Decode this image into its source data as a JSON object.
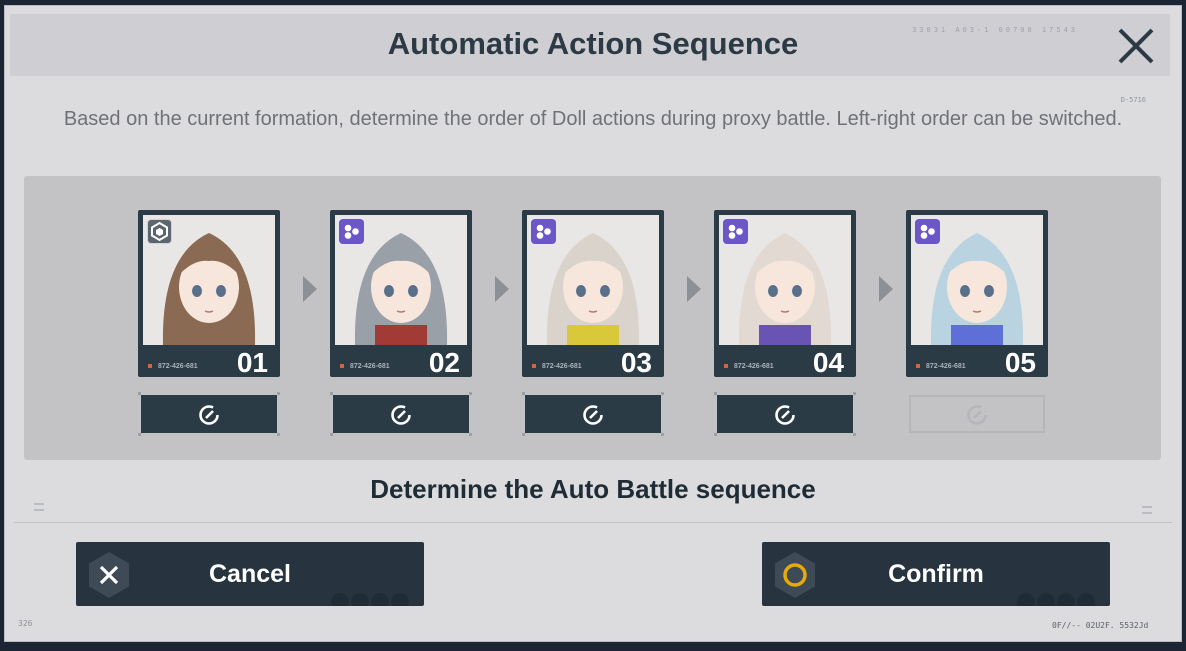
{
  "dialog": {
    "title": "Automatic Action Sequence",
    "serial_text": "33031 A03-1 00700 17543",
    "ref_code": "D-5716",
    "description": "Based on the current formation, determine the order of Doll actions during proxy battle. Left-right order can be switched.",
    "footer_label": "Determine the Auto Battle sequence",
    "bottom_left_code": "326",
    "bottom_right_code": "0F//-- 02U2F. 5532Jd"
  },
  "dolls": [
    {
      "number": "01",
      "code": "872-426-681",
      "class_icon": "defense-class-icon",
      "action_enabled": true,
      "hair": "#8a6a52",
      "accent": "#8a6a52"
    },
    {
      "number": "02",
      "code": "872-426-681",
      "class_icon": "arts-class-icon",
      "action_enabled": true,
      "hair": "#9aa0a8",
      "accent": "#a23a35"
    },
    {
      "number": "03",
      "code": "872-426-681",
      "class_icon": "arts-class-icon",
      "action_enabled": true,
      "hair": "#d9d3cb",
      "accent": "#d9c93a"
    },
    {
      "number": "04",
      "code": "872-426-681",
      "class_icon": "arts-class-icon",
      "action_enabled": true,
      "hair": "#e2dad2",
      "accent": "#6a54b3"
    },
    {
      "number": "05",
      "code": "872-426-681",
      "class_icon": "arts-class-icon",
      "action_enabled": false,
      "hair": "#b9d4e0",
      "accent": "#5f6fd8"
    }
  ],
  "buttons": {
    "cancel_label": "Cancel",
    "confirm_label": "Confirm"
  },
  "colors": {
    "accent_confirm": "#e8a90c",
    "arts_badge": "#6b57c7",
    "panel_dark": "#2b3b45"
  }
}
